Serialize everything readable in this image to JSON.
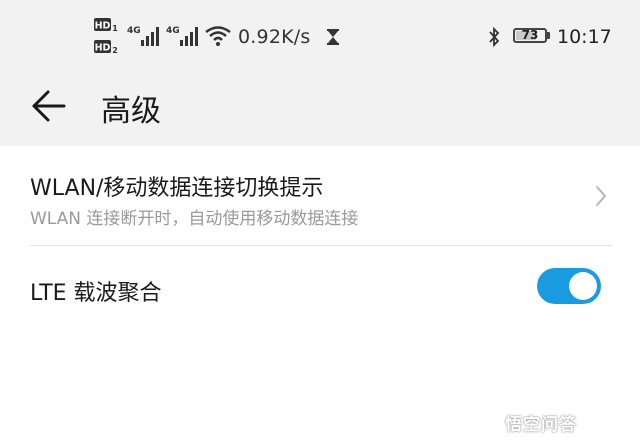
{
  "status_bar": {
    "hd1": "HD",
    "hd2": "HD",
    "net1": "4G",
    "net2": "4G",
    "speed": "0.92K/s",
    "battery": "73",
    "battery_level": 0.73,
    "time": "10:17"
  },
  "header": {
    "title": "高级"
  },
  "settings": [
    {
      "title": "WLAN/移动数据连接切换提示",
      "subtitle": "WLAN 连接断开时，自动使用移动数据连接"
    },
    {
      "title": "LTE 载波聚合",
      "toggle_on": true
    }
  ],
  "watermark": "悟空问答",
  "colors": {
    "accent": "#1a9be0",
    "background_top": "#f2f2f2"
  }
}
